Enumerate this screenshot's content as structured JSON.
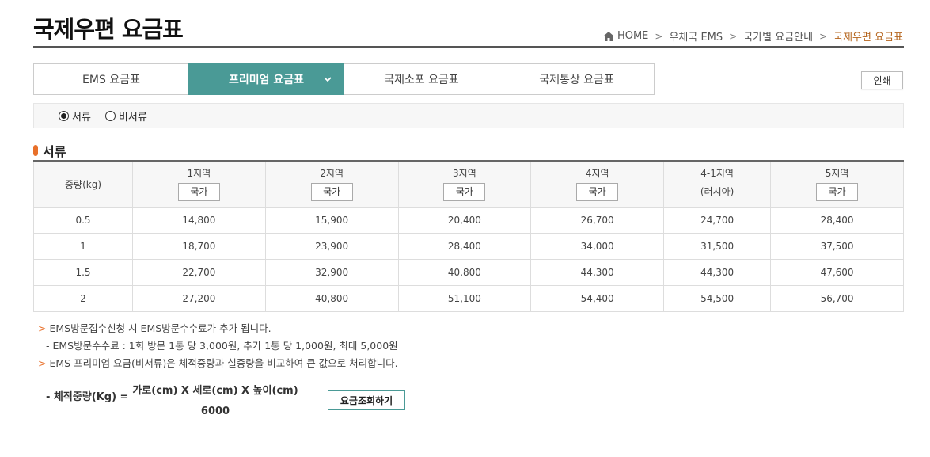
{
  "page_title": "국제우편 요금표",
  "breadcrumb": {
    "items": [
      "HOME",
      "우체국 EMS",
      "국가별 요금안내",
      "국제우편 요금표"
    ],
    "current_color": "#b5651d"
  },
  "tabs": [
    {
      "label": "EMS 요금표",
      "active": false
    },
    {
      "label": "프리미엄 요금표",
      "active": true
    },
    {
      "label": "국제소포 요금표",
      "active": false
    },
    {
      "label": "국제통상 요금표",
      "active": false
    }
  ],
  "print_label": "인쇄",
  "radio": {
    "options": [
      {
        "label": "서류",
        "checked": true
      },
      {
        "label": "비서류",
        "checked": false
      }
    ]
  },
  "section_title": "서류",
  "table": {
    "weight_header": "중량(kg)",
    "zones": [
      {
        "name": "1지역",
        "button": "국가"
      },
      {
        "name": "2지역",
        "button": "국가"
      },
      {
        "name": "3지역",
        "button": "국가"
      },
      {
        "name": "4지역",
        "button": "국가"
      },
      {
        "name": "4-1지역",
        "sub": "(러시아)"
      },
      {
        "name": "5지역",
        "button": "국가"
      }
    ],
    "rows": [
      {
        "weight": "0.5",
        "values": [
          "14,800",
          "15,900",
          "20,400",
          "26,700",
          "24,700",
          "28,400"
        ]
      },
      {
        "weight": "1",
        "values": [
          "18,700",
          "23,900",
          "28,400",
          "34,000",
          "31,500",
          "37,500"
        ]
      },
      {
        "weight": "1.5",
        "values": [
          "22,700",
          "32,900",
          "40,800",
          "44,300",
          "44,300",
          "47,600"
        ]
      },
      {
        "weight": "2",
        "values": [
          "27,200",
          "40,800",
          "51,100",
          "54,400",
          "54,500",
          "56,700"
        ]
      }
    ]
  },
  "notes": {
    "line1": "EMS방문접수신청 시 EMS방문수수료가 추가 됩니다.",
    "line2": "- EMS방문수수료 : 1회 방문 1통 당 3,000원, 추가 1통 당 1,000원, 최대 5,000원",
    "line3": "EMS 프리미엄 요금(비서류)은 체적중량과 실중량을 비교하여 큰 값으로 처리합니다."
  },
  "formula": {
    "label": "- 체적중량(Kg) =",
    "numerator": "가로(cm) X 세로(cm) X 높이(cm)",
    "denominator": "6000"
  },
  "calc_button": "요금조회하기",
  "colors": {
    "accent": "#4a9a96",
    "bullet": "#e8702a"
  }
}
